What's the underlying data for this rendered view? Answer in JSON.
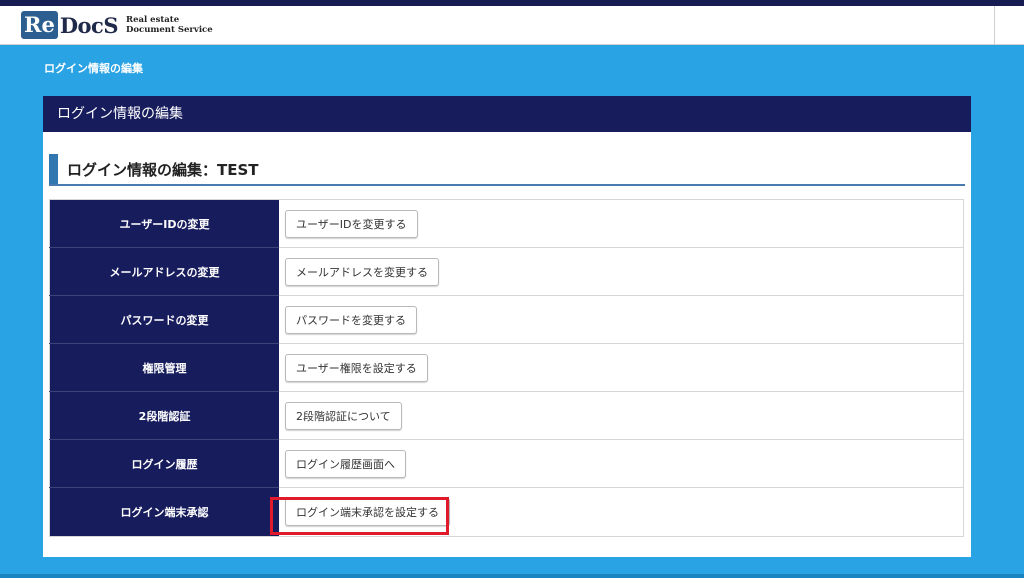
{
  "header": {
    "logo": {
      "re": "Re",
      "docs": "DocS",
      "tagline_line1": "Real estate",
      "tagline_line2": "Document Service"
    }
  },
  "breadcrumb": "ログイン情報の編集",
  "panel": {
    "title": "ログイン情報の編集",
    "section_title": "ログイン情報の編集：TEST"
  },
  "rows": [
    {
      "label": "ユーザーIDの変更",
      "button": "ユーザーIDを変更する"
    },
    {
      "label": "メールアドレスの変更",
      "button": "メールアドレスを変更する"
    },
    {
      "label": "パスワードの変更",
      "button": "パスワードを変更する"
    },
    {
      "label": "権限管理",
      "button": "ユーザー権限を設定する"
    },
    {
      "label": "2段階認証",
      "button": "2段階認証について"
    },
    {
      "label": "ログイン履歴",
      "button": "ログイン履歴画面へ"
    },
    {
      "label": "ログイン端末承認",
      "button": "ログイン端末承認を設定する"
    }
  ],
  "colors": {
    "background": "#2aa3e4",
    "navy": "#171c5d",
    "highlight": "#e0192b"
  }
}
